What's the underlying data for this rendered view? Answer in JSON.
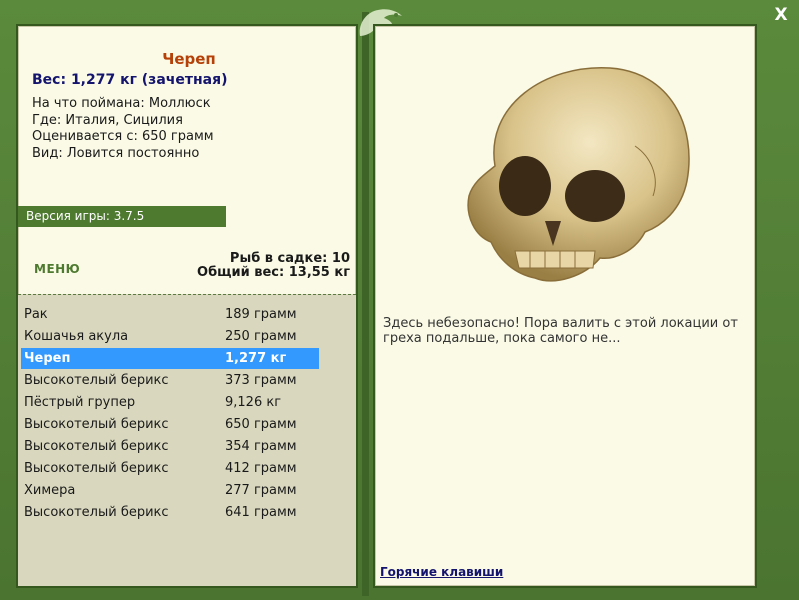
{
  "window": {
    "close_label": "X"
  },
  "fish": {
    "title": "Череп",
    "weight_line": "Вес: 1,277 кг (зачетная)",
    "caught_on": "На что поймана: Моллюск",
    "location": "Где: Италия, Сицилия",
    "value": "Оценивается с: 650 грамм",
    "kind": "Вид: Ловится постоянно"
  },
  "version": "Версия игры: 3.7.5",
  "menu_label": "МЕНЮ",
  "stats": {
    "fish_count": "Рыб в садке: 10",
    "total_weight": "Общий вес: 13,55 кг"
  },
  "catch_list": [
    {
      "name": "Рак",
      "weight": "189 грамм"
    },
    {
      "name": "Кошачья акула",
      "weight": "250 грамм"
    },
    {
      "name": "Череп",
      "weight": "1,277 кг",
      "selected": true
    },
    {
      "name": "Высокотелый берикс",
      "weight": "373 грамм"
    },
    {
      "name": "Пёстрый групер",
      "weight": "9,126 кг"
    },
    {
      "name": "Высокотелый берикс",
      "weight": "650 грамм"
    },
    {
      "name": "Высокотелый берикс",
      "weight": "354 грамм"
    },
    {
      "name": "Высокотелый берикс",
      "weight": "412 грамм"
    },
    {
      "name": "Химера",
      "weight": "277 грамм"
    },
    {
      "name": "Высокотелый берикс",
      "weight": "641 грамм"
    }
  ],
  "message": "Здесь небезопасно! Пора валить с этой локации от греха подальше, пока самого не...",
  "hotkeys_label": "Горячие клавиши",
  "colors": {
    "frame_green": "#4f7a34",
    "panel_bg": "#fafae6",
    "title_orange": "#b54008",
    "weight_navy": "#14146e",
    "selected_blue": "#3399ff"
  }
}
